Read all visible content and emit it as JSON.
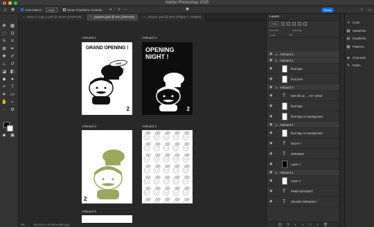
{
  "app": {
    "title": "Adobe Photoshop 2025",
    "window_controls": [
      "close",
      "minimize",
      "zoom"
    ]
  },
  "options_bar": {
    "move_tool_icon": "move-icon",
    "auto_select_label": "Auto-Select:",
    "auto_select_target": "Layer",
    "show_transform_label": "Show Transform Controls",
    "share_label": "Share"
  },
  "tabs": [
    {
      "label": "menu 1 copy 1.psd @ 45.4% (CMYK/8)",
      "active": false
    },
    {
      "label": "posters.psd @ 5% (CMYK/8)",
      "active": true
    },
    {
      "label": "colours .psd @ 50% (Ellipse 1, RGB/8)",
      "active": false
    }
  ],
  "canvas": {
    "artboards": [
      {
        "label": "Artboard 1",
        "kind": "grand-opening-white",
        "headline": "GRAND OPENING !",
        "badge": "FREE DESSERT",
        "corner": "2"
      },
      {
        "label": "Artboard 4",
        "kind": "opening-night-black",
        "headline": "OPENING NIGHT !",
        "corner": "2"
      },
      {
        "label": "Artboard 3",
        "kind": "green-logo",
        "corner": "2"
      },
      {
        "label": "Artboard 2",
        "kind": "pattern"
      },
      {
        "label": "Artboard 5",
        "kind": "blank"
      }
    ]
  },
  "status": {
    "zoom": "5%",
    "dimensions": "53.213 in x 122.84 in (300 ppi)"
  },
  "layers_panel": {
    "title": "Layers",
    "filter_kind": "Kind",
    "mode": "Normal",
    "opacity_label": "Opacity:",
    "lock_label": "Lock:",
    "fill_label": "Fill:",
    "rows": [
      {
        "type": "group",
        "label": "Artboard 5"
      },
      {
        "type": "group",
        "label": "Artboard 2"
      },
      {
        "type": "layer",
        "label": "final logo",
        "thumb": "image"
      },
      {
        "type": "layer",
        "label": "final print",
        "thumb": "image"
      },
      {
        "type": "group",
        "label": "Artboard 3"
      },
      {
        "type": "layer",
        "label": "536 Sth av ..., NY 10018",
        "thumb": "text"
      },
      {
        "type": "layer",
        "label": "final logo",
        "thumb": "image"
      },
      {
        "type": "layer",
        "label": "final logo no background",
        "thumb": "image"
      },
      {
        "type": "group",
        "label": "Artboard 4"
      },
      {
        "type": "layer",
        "label": "final logo no background",
        "thumb": "image"
      },
      {
        "type": "layer",
        "label": "NIGHT !",
        "thumb": "text"
      },
      {
        "type": "layer",
        "label": "OPENING",
        "thumb": "text"
      },
      {
        "type": "layer",
        "label": "Layer 1",
        "thumb": "black"
      },
      {
        "type": "group",
        "label": "Artboard 1"
      },
      {
        "type": "layer",
        "label": "Layer 2",
        "thumb": "image"
      },
      {
        "type": "layer",
        "label": "FREE DESSERT",
        "thumb": "text"
      },
      {
        "type": "layer",
        "label": "GRAND OPENING !",
        "thumb": "text"
      }
    ]
  },
  "right_panel": {
    "items": [
      {
        "label": "Color",
        "icon": "color-wheel-icon"
      },
      {
        "label": "Swatches",
        "icon": "swatches-icon"
      },
      {
        "label": "Gradients",
        "icon": "gradient-icon"
      },
      {
        "label": "Patterns",
        "icon": "patterns-icon"
      },
      {
        "label": "Channels",
        "icon": "channels-icon"
      },
      {
        "label": "Paths",
        "icon": "paths-icon"
      }
    ]
  },
  "colors": {
    "accent": "#1473e6",
    "artboard_green": "#9aa860",
    "foreground": "#000000",
    "background": "#ffffff"
  }
}
